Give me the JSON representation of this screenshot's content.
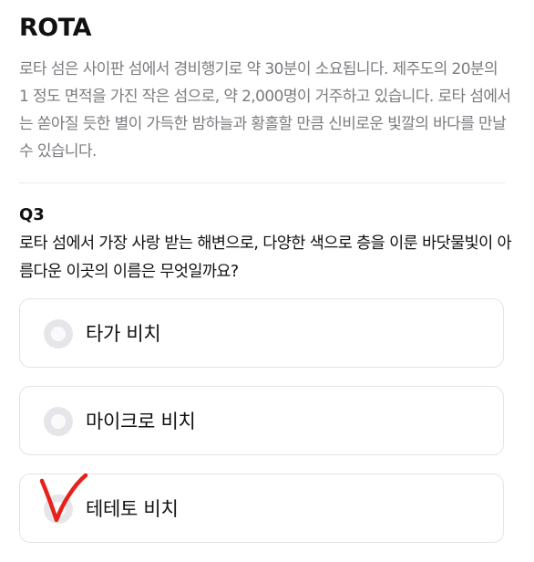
{
  "header": {
    "title": "ROTA"
  },
  "description": "로타 섬은 사이판 섬에서 경비행기로 약 30분이 소요됩니다. 제주도의 20분의 1 정도 면적을 가진 작은 섬으로, 약 2,000명이 거주하고 있습니다. 로타 섬에서는 쏟아질 듯한 별이 가득한 밤하늘과 황홀할 만큼 신비로운 빛깔의 바다를 만날 수 있습니다.",
  "question": {
    "number": "Q3",
    "text": "로타 섬에서 가장 사랑 받는 해변으로, 다양한 색으로 층을 이룬 바닷물빛이 아름다운 이곳의 이름은 무엇일까요?",
    "options": [
      {
        "label": "타가 비치"
      },
      {
        "label": "마이크로 비치"
      },
      {
        "label": "테테토 비치"
      }
    ]
  },
  "annotation": {
    "mark": "check-mark-icon",
    "marked_option": "테테토 비치",
    "color": "#e8201a"
  },
  "colors": {
    "description_text": "#7b7b80",
    "border": "#e3e3e8",
    "radio": "#e6e6ea"
  }
}
